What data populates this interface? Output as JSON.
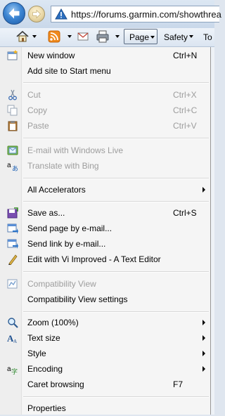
{
  "address_bar": {
    "url": "https://forums.garmin.com/showthrea"
  },
  "command_bar": {
    "page_label": "Page",
    "safety_label": "Safety",
    "tools_label": "To"
  },
  "menu": {
    "new_window": {
      "label": "New window",
      "shortcut": "Ctrl+N"
    },
    "add_site": {
      "label": "Add site to Start menu"
    },
    "cut": {
      "label": "Cut",
      "shortcut": "Ctrl+X"
    },
    "copy": {
      "label": "Copy",
      "shortcut": "Ctrl+C"
    },
    "paste": {
      "label": "Paste",
      "shortcut": "Ctrl+V"
    },
    "email_live": {
      "label": "E-mail with Windows Live"
    },
    "translate": {
      "label": "Translate with Bing"
    },
    "accelerators": {
      "label": "All Accelerators"
    },
    "save_as": {
      "label": "Save as...",
      "shortcut": "Ctrl+S"
    },
    "send_page": {
      "label": "Send page by e-mail..."
    },
    "send_link": {
      "label": "Send link by e-mail..."
    },
    "edit_vim": {
      "label": "Edit with Vi Improved - A Text Editor"
    },
    "compat_view": {
      "label": "Compatibility View"
    },
    "compat_settings": {
      "label": "Compatibility View settings"
    },
    "zoom": {
      "label": "Zoom (100%)"
    },
    "text_size": {
      "label": "Text size"
    },
    "style": {
      "label": "Style"
    },
    "encoding": {
      "label": "Encoding"
    },
    "caret_browsing": {
      "label": "Caret browsing",
      "shortcut": "F7"
    },
    "properties": {
      "label": "Properties"
    }
  }
}
